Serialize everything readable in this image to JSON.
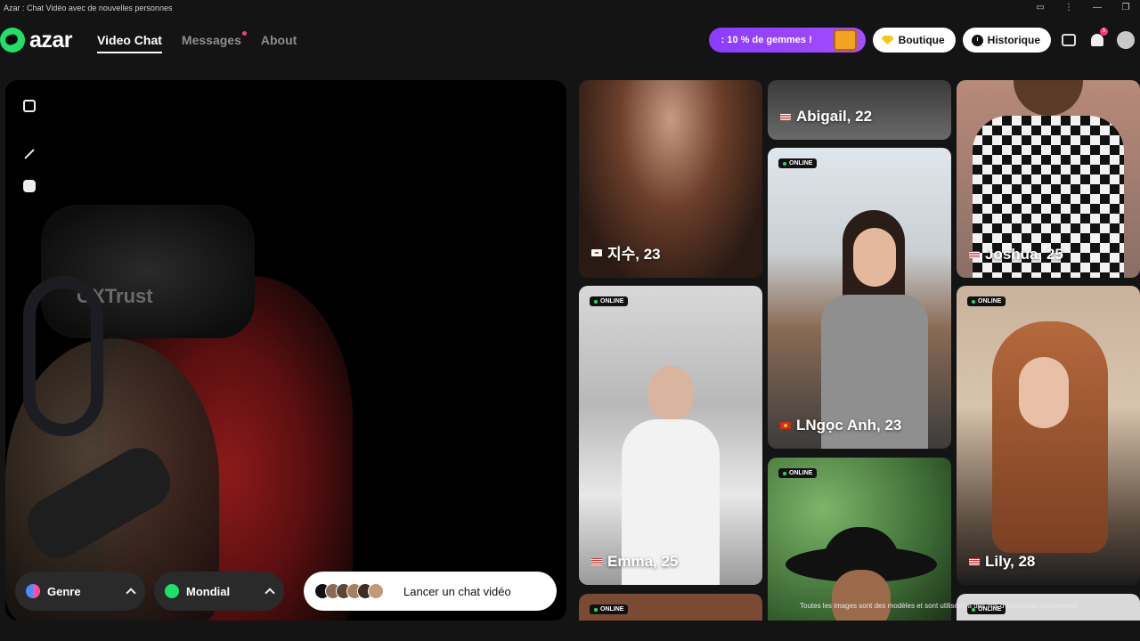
{
  "window": {
    "title": "Azar : Chat Vidéo avec de nouvelles personnes",
    "controls": [
      "▭",
      "⋮",
      "—",
      "❐"
    ]
  },
  "header": {
    "logo_text": "azar",
    "nav": [
      {
        "label": "Video Chat",
        "active": true
      },
      {
        "label": "Messages",
        "has_dot": true
      },
      {
        "label": "About"
      }
    ],
    "promo": ": 10 % de gemmes !",
    "boutique": "Boutique",
    "historique": "Historique",
    "notification_count": "5"
  },
  "video": {
    "filters": {
      "gender": "Genre",
      "region": "Mondial"
    },
    "launch_label": "Lancer un chat vidéo",
    "cam_brand": "GXTrust"
  },
  "profiles": [
    {
      "name": "지수, 23",
      "online": false,
      "flag": "KR"
    },
    {
      "name": "Emma, 25",
      "online": true,
      "flag": "US"
    },
    {
      "name": "",
      "online": true,
      "flag": ""
    },
    {
      "name": "Abigail, 22",
      "online": false,
      "flag": "US"
    },
    {
      "name": "LNgọc Anh, 23",
      "online": true,
      "flag": "VN"
    },
    {
      "name": "",
      "online": true,
      "flag": ""
    },
    {
      "name": "Joshua, 25",
      "online": false,
      "flag": "US"
    },
    {
      "name": "Lily, 28",
      "online": true,
      "flag": "US"
    },
    {
      "name": "",
      "online": true,
      "flag": ""
    }
  ],
  "online_label": "ONLINE",
  "disclaimer": "Toutes les images sont des modèles et sont utilisées à des fins d'illustration uniquement.",
  "colors": {
    "brand_green": "#20e06a",
    "promo_purple": "#9b45ff",
    "background": "#141414"
  }
}
